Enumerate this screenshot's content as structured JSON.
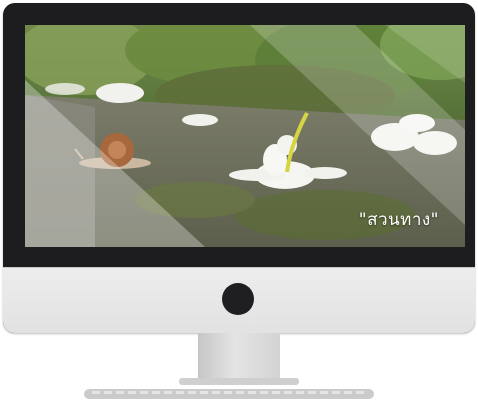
{
  "video": {
    "caption": "\"สวนทาง\""
  },
  "colors": {
    "bezel": "#1d1d1f",
    "chin": "#e6e6e6",
    "stand": "#d0d0d0"
  }
}
